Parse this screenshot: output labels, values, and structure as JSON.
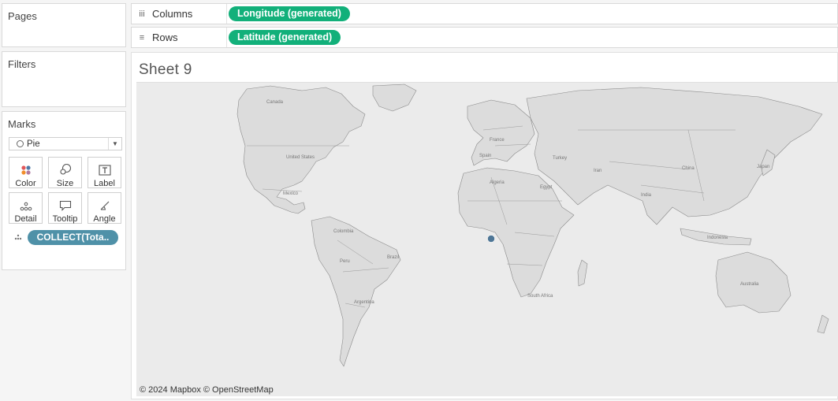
{
  "pages": {
    "title": "Pages"
  },
  "filters": {
    "title": "Filters"
  },
  "marks": {
    "title": "Marks",
    "mark_type": "Pie",
    "buttons": [
      {
        "label": "Color",
        "icon": "color-dots-icon"
      },
      {
        "label": "Size",
        "icon": "size-icon"
      },
      {
        "label": "Label",
        "icon": "label-icon"
      },
      {
        "label": "Detail",
        "icon": "detail-icon"
      },
      {
        "label": "Tooltip",
        "icon": "tooltip-icon"
      },
      {
        "label": "Angle",
        "icon": "angle-icon"
      }
    ],
    "field_pill": "COLLECT(Tota.."
  },
  "shelves": {
    "columns": {
      "label": "Columns",
      "pill": "Longitude (generated)"
    },
    "rows": {
      "label": "Rows",
      "pill": "Latitude (generated)"
    }
  },
  "sheet": {
    "title": "Sheet 9",
    "attribution": "© 2024 Mapbox © OpenStreetMap",
    "map_labels": [
      "Canada",
      "United States",
      "Mexico",
      "Colombia",
      "Peru",
      "Brazil",
      "Argentina",
      "France",
      "Spain",
      "Algeria",
      "Egypt",
      "Turkey",
      "Iran",
      "India",
      "China",
      "Japan",
      "Indonesia",
      "Australia",
      "South Africa"
    ]
  },
  "colors": {
    "pill_green": "#12b07a",
    "pill_blue": "#4f91a8",
    "land": "#dcdcdc",
    "ocean": "#ebebeb",
    "mark": "#4e7696"
  }
}
